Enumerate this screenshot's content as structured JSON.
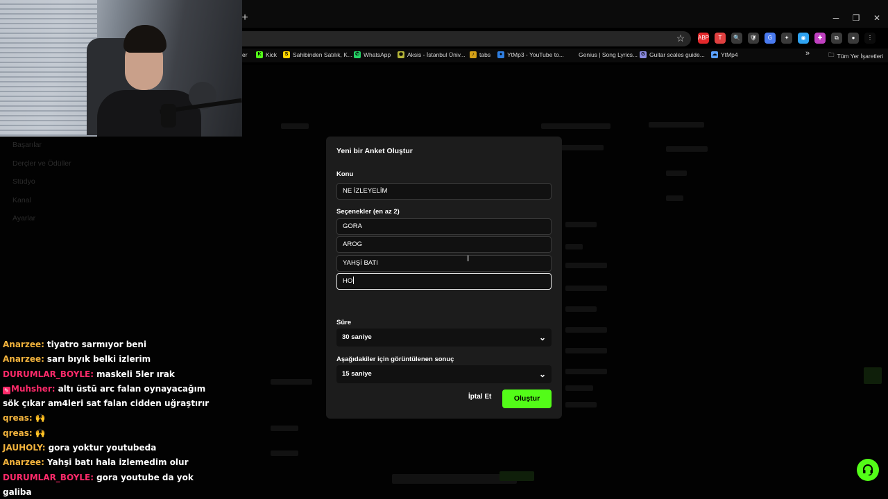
{
  "browser": {
    "new_tab": "+",
    "window_controls": [
      "─",
      "❐",
      "✕"
    ],
    "extensions": [
      {
        "icon": "adblock-icon",
        "color": "#e3282b",
        "text": "ABP"
      },
      {
        "icon": "translate-icon",
        "color": "#e04040",
        "text": "T"
      },
      {
        "icon": "search-icon",
        "color": "#3a3a3a",
        "text": "🔍"
      },
      {
        "icon": "shield-icon",
        "color": "#3a3a3a",
        "text": "🛡"
      },
      {
        "icon": "google-translate-icon",
        "color": "#4a7bf0",
        "text": "G"
      },
      {
        "icon": "deepl-icon",
        "color": "#3a3a3a",
        "text": "✦"
      },
      {
        "icon": "vpn-icon",
        "color": "#2ea3f2",
        "text": "◉"
      },
      {
        "icon": "extension-icon",
        "color": "#c040c0",
        "text": "✚"
      },
      {
        "icon": "puzzle-icon",
        "color": "#3a3a3a",
        "text": "⧉"
      },
      {
        "icon": "profile-icon",
        "color": "#3a3a3a",
        "text": "●"
      },
      {
        "icon": "menu-icon",
        "color": "#0b0b0b",
        "text": "⋮"
      }
    ],
    "bookmarks": [
      {
        "label": "er",
        "icon": "",
        "color": ""
      },
      {
        "label": "Kick",
        "icon": "K",
        "color": "#53fc18"
      },
      {
        "label": "Sahibinden Satılık, K...",
        "icon": "S",
        "color": "#ffd400"
      },
      {
        "label": "WhatsApp",
        "icon": "✆",
        "color": "#25d366"
      },
      {
        "label": "Aksis - İstanbul Üniv...",
        "icon": "◉",
        "color": "#b5b53a"
      },
      {
        "label": "tabs",
        "icon": "♪",
        "color": "#d4a017"
      },
      {
        "label": "YtMp3 - YouTube to...",
        "icon": "●",
        "color": "#2f7ee0"
      },
      {
        "label": "Genius | Song Lyrics...",
        "icon": "",
        "color": ""
      },
      {
        "label": "Guitar scales guide...",
        "icon": "G",
        "color": "#8a8ae0"
      },
      {
        "label": "YtMp4",
        "icon": "☁",
        "color": "#5aa0ff"
      }
    ],
    "more_bookmarks": "»",
    "all_bookmarks": "Tüm Yer İşaretleri"
  },
  "sidebar_nav": [
    "Başarılar",
    "Derçler ve Ödüller",
    "Stüdyo",
    "Kanal",
    "Ayarlar"
  ],
  "chat": [
    {
      "user": "Anarzee:",
      "color": "#f2b33d",
      "text": "tiyatro sarmıyor beni",
      "badge": false
    },
    {
      "user": "Anarzee:",
      "color": "#f2b33d",
      "text": "sarı bıyık belki izlerim",
      "badge": false
    },
    {
      "user": "DURUMLAR_BOYLE:",
      "color": "#ff2a6a",
      "text": "maskeli 5ler ırak",
      "badge": false
    },
    {
      "user": "Muhsher:",
      "color": "#ff2a6a",
      "text": "altı üstü arc falan oynayacağım",
      "badge": true
    },
    {
      "user": "",
      "color": "#ffffff",
      "text": "sök çıkar am4leri sat falan cidden uğraştırır",
      "badge": false
    },
    {
      "user": "qreas:",
      "color": "#f2b33d",
      "text": "🙌",
      "badge": false
    },
    {
      "user": "qreas:",
      "color": "#f2b33d",
      "text": "🙌",
      "badge": false
    },
    {
      "user": "JAUHOLY:",
      "color": "#f2b33d",
      "text": "gora yoktur youtubeda",
      "badge": false
    },
    {
      "user": "Anarzee:",
      "color": "#f2b33d",
      "text": "Yahşi batı hala izlemedim olur",
      "badge": false
    },
    {
      "user": "DURUMLAR_BOYLE:",
      "color": "#ff2a6a",
      "text": "gora youtube da yok",
      "badge": false
    },
    {
      "user": "",
      "color": "#ffffff",
      "text": "galiba",
      "badge": false
    }
  ],
  "modal": {
    "title": "Yeni bir Anket Oluştur",
    "topic_label": "Konu",
    "topic_value": "NE İZLEYELİM",
    "options_label": "Seçenekler (en az 2)",
    "options": [
      "GORA",
      "AROG",
      "YAHŞİ BATI",
      "HO"
    ],
    "duration_label": "Süre",
    "duration_value": "30 saniye",
    "result_label": "Aşağıdakiler için görüntülenen sonuç",
    "result_value": "15 saniye",
    "cancel_label": "İptal Et",
    "create_label": "Oluştur"
  },
  "colors": {
    "accent": "#53fc18",
    "modal_bg": "#1c1c1c"
  }
}
